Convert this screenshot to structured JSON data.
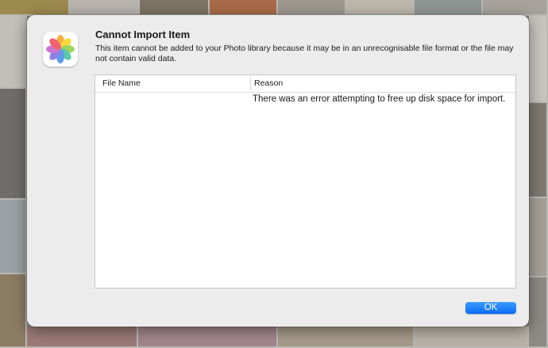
{
  "dialog": {
    "title": "Cannot Import Item",
    "message": "This item cannot be added to your Photo library because it may be in an unrecognisable file format or the file may not contain valid data.",
    "app_icon": "photos-app-icon",
    "ok_label": "OK"
  },
  "table": {
    "columns": [
      "File Name",
      "Reason"
    ],
    "rows": [
      {
        "file_name": "",
        "reason": "There was an error attempting to free up disk space for import."
      }
    ]
  },
  "colors": {
    "accent": "#0a6cf5",
    "dialog_bg": "#ececec"
  }
}
